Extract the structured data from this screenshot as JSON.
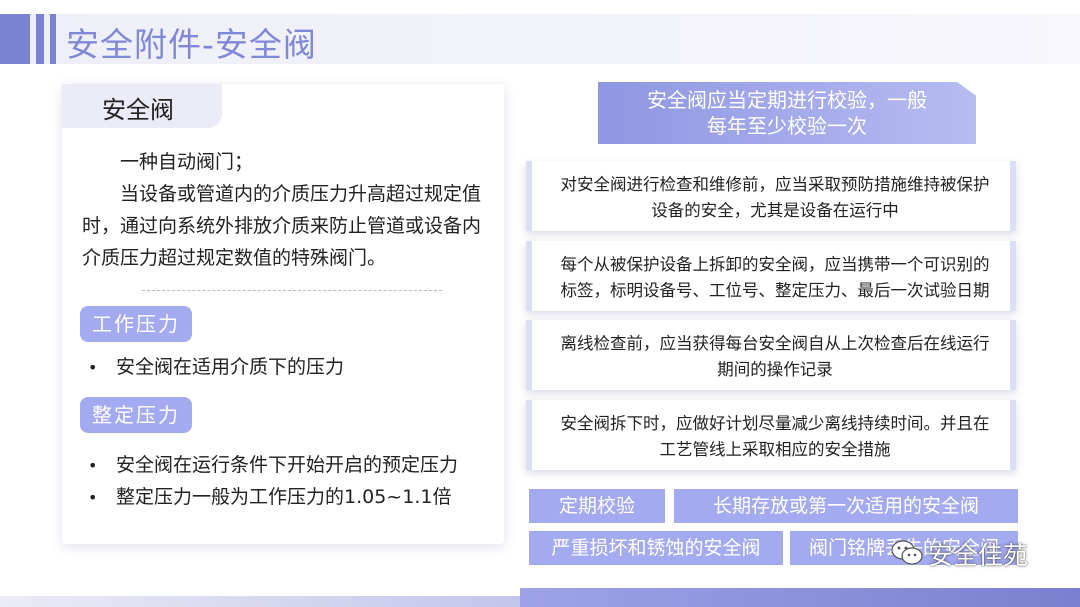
{
  "header": {
    "title": "安全附件-安全阀"
  },
  "left": {
    "tab_label": "安全阀",
    "definition_line1": "一种自动阀门；",
    "definition_line2": "当设备或管道内的介质压力升高超过规定值时，通过向系统外排放介质来防止管道或设备内介质压力超过规定数值的特殊阀门。",
    "working_pressure": {
      "label": "工作压力",
      "items": [
        "安全阀在适用介质下的压力"
      ]
    },
    "set_pressure": {
      "label": "整定压力",
      "items": [
        "安全阀在运行条件下开始开启的预定压力",
        "整定压力一般为工作压力的1.05~1.1倍"
      ]
    }
  },
  "right": {
    "heading_line1": "安全阀应当定期进行校验，一般",
    "heading_line2": "每年至少校验一次",
    "boxes": [
      {
        "line1": "对安全阀进行检查和维修前，应当采取预防措施维持被保护",
        "line2": "设备的安全，尤其是设备在运行中"
      },
      {
        "line1": "每个从被保护设备上拆卸的安全阀，应当携带一个可识别的",
        "line2": "标签，标明设备号、工位号、整定压力、最后一次试验日期"
      },
      {
        "line1": "离线检查前，应当获得每台安全阀自从上次检查后在线运行",
        "line2": "期间的操作记录"
      },
      {
        "line1": "安全阀拆下时，应做好计划尽量减少离线持续时间。并且在",
        "line2": "工艺管线上采取相应的安全措施"
      }
    ],
    "tags": [
      "定期校验",
      "长期存放或第一次适用的安全阀",
      "严重损坏和锈蚀的安全阀",
      "阀门铭牌丢失的安全阀"
    ]
  },
  "watermark": {
    "text": "安全佳苑",
    "icon": "wechat-icon"
  },
  "colors": {
    "accent": "#8087d6",
    "chip": "#a4aaf0",
    "header_band": "#eeeef8"
  }
}
